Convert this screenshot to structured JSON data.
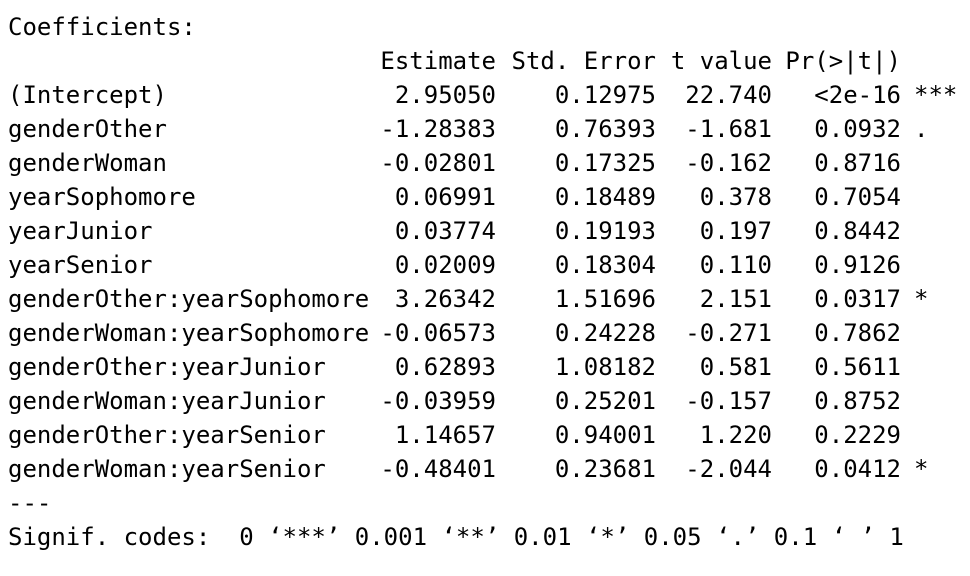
{
  "title": "Coefficients:",
  "headers": {
    "estimate": "Estimate",
    "std_error": "Std. Error",
    "t_value": "t value",
    "p_value": "Pr(>|t|)"
  },
  "rows": [
    {
      "term": "(Intercept)",
      "estimate": "2.95050",
      "std_error": "0.12975",
      "t_value": "22.740",
      "p_value": "<2e-16",
      "signif": "***"
    },
    {
      "term": "genderOther",
      "estimate": "-1.28383",
      "std_error": "0.76393",
      "t_value": "-1.681",
      "p_value": "0.0932",
      "signif": "."
    },
    {
      "term": "genderWoman",
      "estimate": "-0.02801",
      "std_error": "0.17325",
      "t_value": "-0.162",
      "p_value": "0.8716",
      "signif": ""
    },
    {
      "term": "yearSophomore",
      "estimate": "0.06991",
      "std_error": "0.18489",
      "t_value": "0.378",
      "p_value": "0.7054",
      "signif": ""
    },
    {
      "term": "yearJunior",
      "estimate": "0.03774",
      "std_error": "0.19193",
      "t_value": "0.197",
      "p_value": "0.8442",
      "signif": ""
    },
    {
      "term": "yearSenior",
      "estimate": "0.02009",
      "std_error": "0.18304",
      "t_value": "0.110",
      "p_value": "0.9126",
      "signif": ""
    },
    {
      "term": "genderOther:yearSophomore",
      "estimate": "3.26342",
      "std_error": "1.51696",
      "t_value": "2.151",
      "p_value": "0.0317",
      "signif": "*"
    },
    {
      "term": "genderWoman:yearSophomore",
      "estimate": "-0.06573",
      "std_error": "0.24228",
      "t_value": "-0.271",
      "p_value": "0.7862",
      "signif": ""
    },
    {
      "term": "genderOther:yearJunior",
      "estimate": "0.62893",
      "std_error": "1.08182",
      "t_value": "0.581",
      "p_value": "0.5611",
      "signif": ""
    },
    {
      "term": "genderWoman:yearJunior",
      "estimate": "-0.03959",
      "std_error": "0.25201",
      "t_value": "-0.157",
      "p_value": "0.8752",
      "signif": ""
    },
    {
      "term": "genderOther:yearSenior",
      "estimate": "1.14657",
      "std_error": "0.94001",
      "t_value": "1.220",
      "p_value": "0.2229",
      "signif": ""
    },
    {
      "term": "genderWoman:yearSenior",
      "estimate": "-0.48401",
      "std_error": "0.23681",
      "t_value": "-2.044",
      "p_value": "0.0412",
      "signif": "*"
    }
  ],
  "separator": "---",
  "signif_codes": "Signif. codes:  0 ‘***’ 0.001 ‘**’ 0.01 ‘*’ 0.05 ‘.’ 0.1 ‘ ’ 1"
}
